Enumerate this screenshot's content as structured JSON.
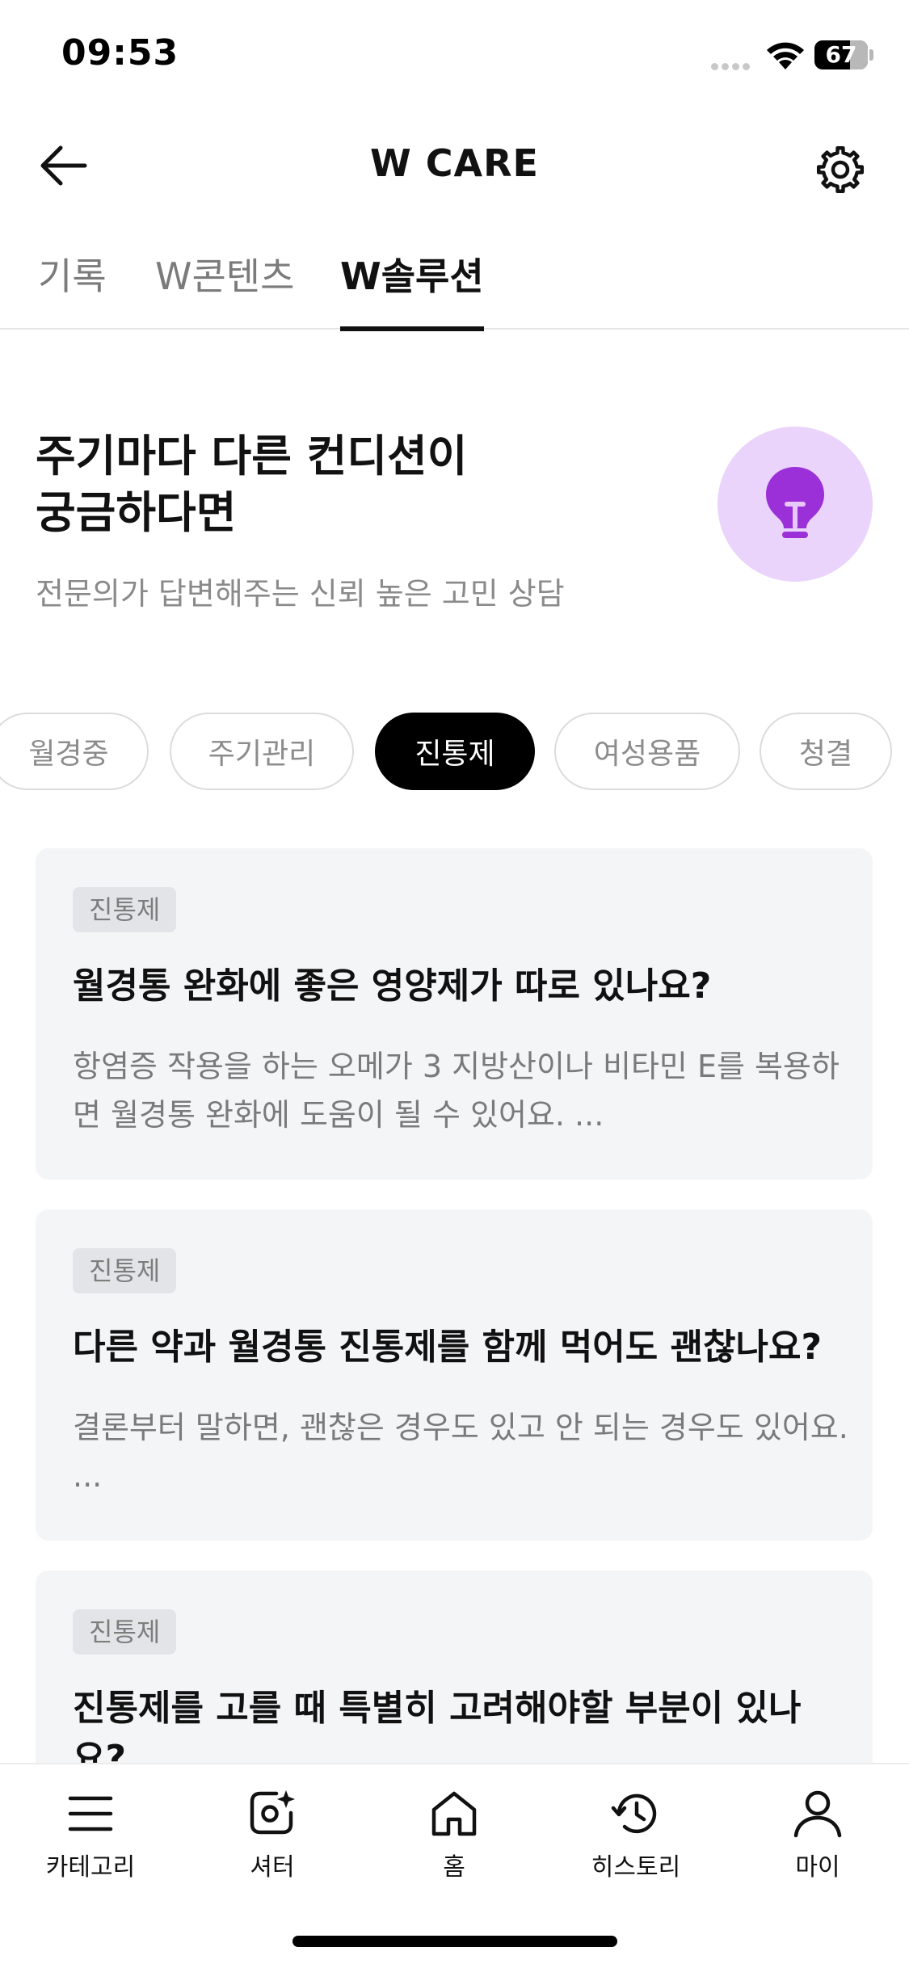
{
  "status_bar": {
    "time": "09:53",
    "battery": "67",
    "battery_level_percent": 67
  },
  "header": {
    "title": "W CARE"
  },
  "tabs": [
    {
      "label": "기록",
      "active": false
    },
    {
      "label": "W콘텐츠",
      "active": false
    },
    {
      "label": "W솔루션",
      "active": true
    }
  ],
  "hero": {
    "title": "주기마다 다른 컨디션이\n궁금하다면",
    "subtitle": "전문의가 답변해주는 신뢰 높은 고민 상담",
    "icon": "lightbulb-icon",
    "icon_bg": "#ead4fb",
    "icon_color": "#9b30d9"
  },
  "chips": [
    {
      "label": "월경중",
      "active": false
    },
    {
      "label": "주기관리",
      "active": false
    },
    {
      "label": "진통제",
      "active": true
    },
    {
      "label": "여성용품",
      "active": false
    },
    {
      "label": "청결",
      "active": false
    }
  ],
  "cards": [
    {
      "badge": "진통제",
      "title": "월경통 완화에 좋은 영양제가 따로 있나요?",
      "body": "항염증 작용을 하는 오메가 3 지방산이나 비타민 E를 복용하면 월경통 완화에 도움이 될 수 있어요. ..."
    },
    {
      "badge": "진통제",
      "title": "다른 약과 월경통 진통제를 함께 먹어도 괜찮나요?",
      "body": "결론부터 말하면, 괜찮은 경우도 있고 안 되는 경우도 있어요. ..."
    },
    {
      "badge": "진통제",
      "title": "진통제를 고를 때 특별히 고려해야할 부분이 있나요?",
      "body": ""
    }
  ],
  "bottom_nav": [
    {
      "label": "카테고리",
      "icon": "menu-icon"
    },
    {
      "label": "셔터",
      "icon": "camera-sparkle-icon"
    },
    {
      "label": "홈",
      "icon": "home-icon"
    },
    {
      "label": "히스토리",
      "icon": "history-icon"
    },
    {
      "label": "마이",
      "icon": "person-icon"
    }
  ]
}
